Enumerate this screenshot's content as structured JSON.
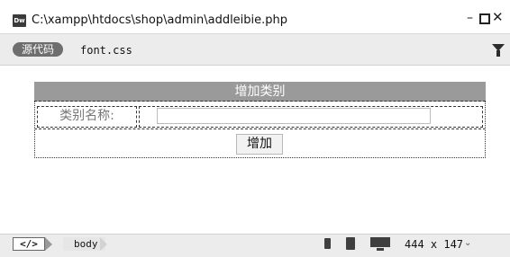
{
  "window": {
    "app_icon_text": "Dw",
    "title": "C:\\xampp\\htdocs\\shop\\admin\\addleibie.php",
    "minimize": "–",
    "close": "✕"
  },
  "filebar": {
    "source_code": "源代码",
    "related_file": "font.css"
  },
  "form": {
    "header": "增加类别",
    "label": "类别名称:",
    "input_value": "",
    "submit_label": "增加"
  },
  "statusbar": {
    "code_tag": "</>",
    "body_tag": "body",
    "viewport_size": "444 x 147",
    "viewport_caret": "⌄"
  },
  "icons": [
    "app-icon",
    "filter-icon",
    "phone-icon",
    "tablet-icon",
    "desktop-icon"
  ]
}
